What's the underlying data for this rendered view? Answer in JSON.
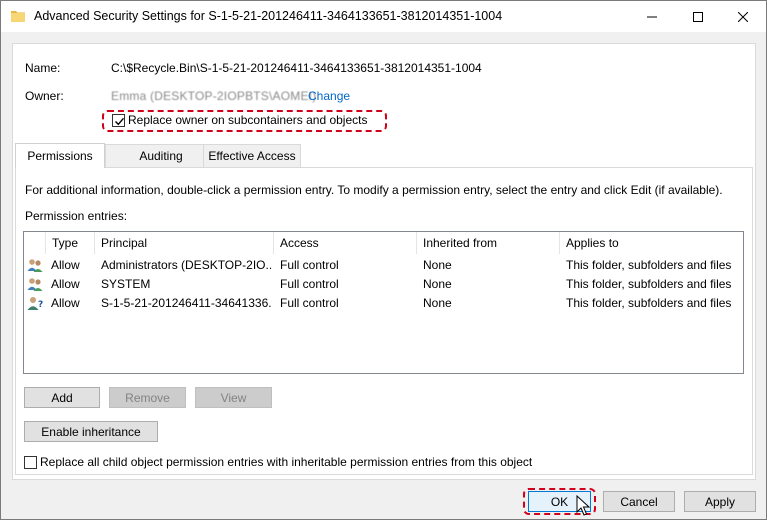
{
  "window": {
    "title": "Advanced Security Settings for S-1-5-21-201246411-3464133651-3812014351-1004"
  },
  "fields": {
    "name_label": "Name:",
    "name_value": "C:\\$Recycle.Bin\\S-1-5-21-201246411-3464133651-3812014351-1004",
    "owner_label": "Owner:",
    "owner_value": "Emma (DESKTOP-2IOPBTS\\AOMEI)",
    "change_link": "Change",
    "replace_owner_label": "Replace owner on subcontainers and objects",
    "replace_owner_checked": true
  },
  "tabs": [
    {
      "label": "Permissions",
      "active": true
    },
    {
      "label": "Auditing",
      "active": false
    },
    {
      "label": "Effective Access",
      "active": false
    }
  ],
  "permissions": {
    "info_text": "For additional information, double-click a permission entry. To modify a permission entry, select the entry and click Edit (if available).",
    "entries_label": "Permission entries:",
    "columns": [
      "Type",
      "Principal",
      "Access",
      "Inherited from",
      "Applies to"
    ],
    "rows": [
      {
        "icon": "users-group-icon",
        "type": "Allow",
        "principal": "Administrators (DESKTOP-2IO...",
        "access": "Full control",
        "inherited": "None",
        "applies": "This folder, subfolders and files"
      },
      {
        "icon": "users-group-icon",
        "type": "Allow",
        "principal": "SYSTEM",
        "access": "Full control",
        "inherited": "None",
        "applies": "This folder, subfolders and files"
      },
      {
        "icon": "unknown-user-icon",
        "type": "Allow",
        "principal": "S-1-5-21-201246411-34641336...",
        "access": "Full control",
        "inherited": "None",
        "applies": "This folder, subfolders and files"
      }
    ],
    "add_button": "Add",
    "remove_button": "Remove",
    "view_button": "View",
    "enable_inheritance_button": "Enable inheritance",
    "replace_child_label": "Replace all child object permission entries with inheritable permission entries from this object",
    "replace_child_checked": false
  },
  "footer": {
    "ok": "OK",
    "cancel": "Cancel",
    "apply": "Apply"
  },
  "colors": {
    "highlight": "#d0021b",
    "link": "#0066cc",
    "accent": "#0078d7"
  }
}
